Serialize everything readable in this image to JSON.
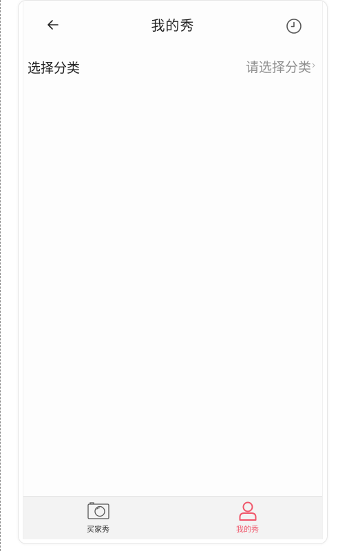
{
  "header": {
    "title": "我的秀",
    "back_icon": "arrow-left-icon",
    "history_icon": "clock-icon"
  },
  "category": {
    "label": "选择分类",
    "placeholder": "请选择分类"
  },
  "tabbar": {
    "items": [
      {
        "label": "买家秀",
        "icon": "camera-icon",
        "active": false
      },
      {
        "label": "我的秀",
        "icon": "user-icon",
        "active": true
      }
    ]
  },
  "colors": {
    "accent": "#f0566a",
    "text": "#222222",
    "muted": "#8f8f8f",
    "tabbar_bg": "#f3f3f3"
  }
}
